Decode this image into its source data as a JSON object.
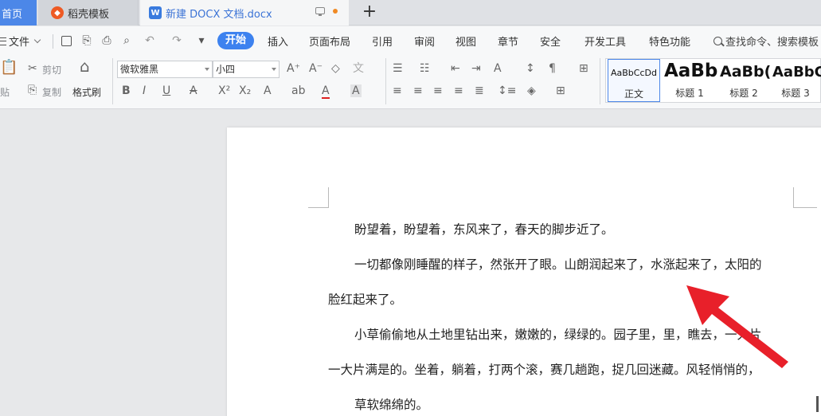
{
  "tabs": {
    "home": "首页",
    "template": "稻壳模板",
    "document": "新建 DOCX 文档.docx",
    "template_icon_text": "◆",
    "word_icon_text": "W",
    "new_tab_symbol": "+"
  },
  "menu": {
    "file": "文件",
    "start": "开始",
    "items": [
      "插入",
      "页面布局",
      "引用",
      "审阅",
      "视图",
      "章节",
      "安全",
      "开发工具",
      "特色功能"
    ],
    "search": "查找命令、搜索模板"
  },
  "ribbon": {
    "paste": "贴",
    "cut": "剪切",
    "copy": "复制",
    "format_painter": "格式刷",
    "font_name": "微软雅黑",
    "font_size": "小四",
    "styles": [
      {
        "preview": "AaBbCcDd",
        "label": "正文"
      },
      {
        "preview": "AaBb",
        "label": "标题 1"
      },
      {
        "preview": "AaBb(",
        "label": "标题 2"
      },
      {
        "preview": "AaBbC",
        "label": "标题 3"
      }
    ]
  },
  "document": {
    "paragraphs": [
      {
        "line1": "盼望着，盼望着，东风来了，春天的脚步近了。",
        "line2": ""
      },
      {
        "line1": "一切都像刚睡醒的样子，然张开了眼。山朗润起来了，水涨起来了，太阳的",
        "line2": "脸红起来了。"
      },
      {
        "line1": "小草偷偷地从土地里钻出来，嫩嫩的，绿绿的。园子里，里，瞧去，一大片",
        "line2": "一大片满是的。坐着，躺着，打两个滚，赛几趟跑，捉几回迷藏。风轻悄悄的，"
      },
      {
        "line1": "草软绵绵的。",
        "line2": ""
      }
    ]
  },
  "colors": {
    "accent": "#3d82ef",
    "annotation_arrow": "#e8202a"
  }
}
